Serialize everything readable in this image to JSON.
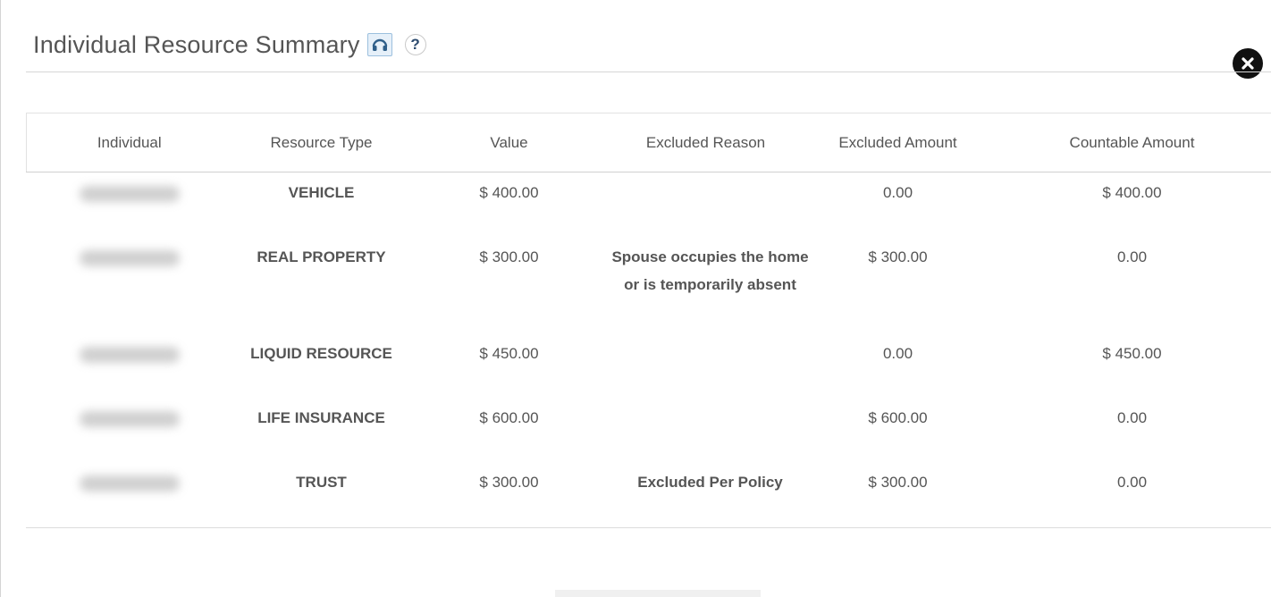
{
  "dialog": {
    "title": "Individual Resource Summary",
    "help_label": "?"
  },
  "table": {
    "headers": [
      "Individual",
      "Resource Type",
      "Value",
      "Excluded Reason",
      "Excluded Amount",
      "Countable Amount"
    ],
    "rows": [
      {
        "individual": "",
        "resource_type": "VEHICLE",
        "value": "$ 400.00",
        "excluded_reason": "",
        "excluded_amount": "0.00",
        "countable_amount": "$ 400.00"
      },
      {
        "individual": "",
        "resource_type": "REAL PROPERTY",
        "value": "$ 300.00",
        "excluded_reason": "Spouse occupies the home or is temporarily absent",
        "excluded_amount": "$ 300.00",
        "countable_amount": "0.00"
      },
      {
        "individual": "",
        "resource_type": "LIQUID RESOURCE",
        "value": "$ 450.00",
        "excluded_reason": "",
        "excluded_amount": "0.00",
        "countable_amount": "$ 450.00"
      },
      {
        "individual": "",
        "resource_type": "LIFE INSURANCE",
        "value": "$ 600.00",
        "excluded_reason": "",
        "excluded_amount": "$ 600.00",
        "countable_amount": "0.00"
      },
      {
        "individual": "",
        "resource_type": "TRUST",
        "value": "$ 300.00",
        "excluded_reason": "Excluded Per Policy",
        "excluded_amount": "$ 300.00",
        "countable_amount": "0.00"
      }
    ]
  },
  "icons": {
    "audio": "headphones-icon",
    "help": "question-icon",
    "close": "close-icon"
  },
  "colors": {
    "audio_button_bg": "#e6f0f9",
    "audio_icon": "#2f5f8a",
    "close_bg": "#111111",
    "text": "#555555"
  }
}
